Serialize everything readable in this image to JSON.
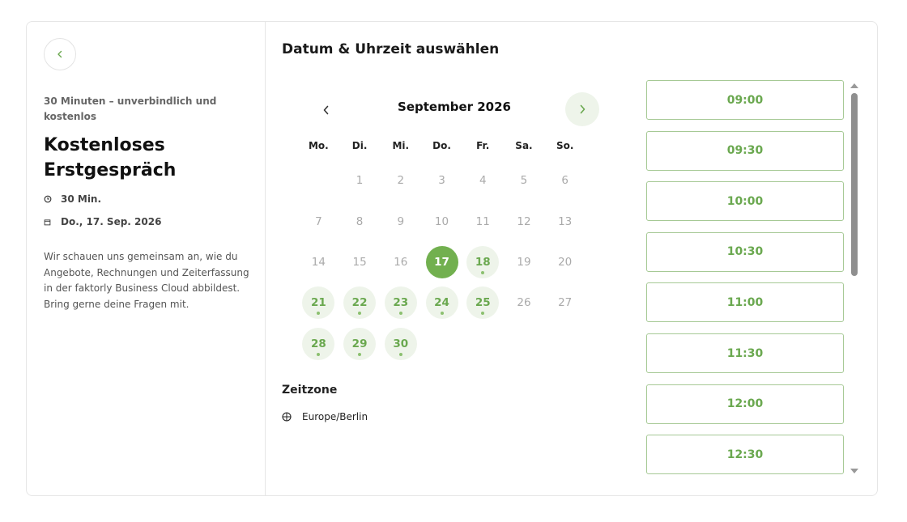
{
  "event": {
    "subtitle": "30 Minuten – unverbindlich und kostenlos",
    "title": "Kostenloses Erstgespräch",
    "duration": "30 Min.",
    "selected_date": "Do., 17. Sep. 2026",
    "description": "Wir schauen uns gemeinsam an, wie du Angebote, Rechnungen und Zeiterfassung in der faktorly Business Cloud abbildest. Bring gerne deine Fragen mit."
  },
  "heading": "Datum & Uhrzeit auswählen",
  "calendar": {
    "month_label": "September 2026",
    "weekdays": [
      "Mo.",
      "Di.",
      "Mi.",
      "Do.",
      "Fr.",
      "Sa.",
      "So."
    ],
    "weeks": [
      [
        null,
        "1",
        "2",
        "3",
        "4",
        "5",
        "6"
      ],
      [
        "7",
        "8",
        "9",
        "10",
        "11",
        "12",
        "13"
      ],
      [
        "14",
        "15",
        "16",
        "17",
        "18",
        "19",
        "20"
      ],
      [
        "21",
        "22",
        "23",
        "24",
        "25",
        "26",
        "27"
      ],
      [
        "28",
        "29",
        "30",
        null,
        null,
        null,
        null
      ]
    ],
    "selected": "17",
    "available": [
      "17",
      "18",
      "21",
      "22",
      "23",
      "24",
      "25",
      "28",
      "29",
      "30"
    ]
  },
  "timezone": {
    "label": "Zeitzone",
    "value": "Europe/Berlin"
  },
  "slots": [
    "09:00",
    "09:30",
    "10:00",
    "10:30",
    "11:00",
    "11:30",
    "12:00",
    "12:30"
  ],
  "colors": {
    "accent": "#72b04f",
    "accent_text": "#6aa84f",
    "available_bg": "#eef4ea",
    "slot_border": "#a6c995"
  },
  "icons": {
    "back": "chevron-left-icon",
    "duration": "clock-icon",
    "date": "calendar-icon",
    "timezone": "globe-icon"
  }
}
